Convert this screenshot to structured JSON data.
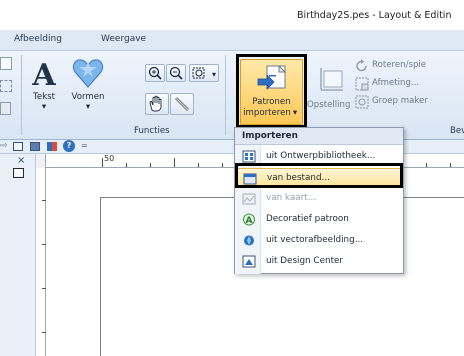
{
  "window": {
    "title": "Birthday2S.pes - Layout & Editin"
  },
  "menu": {
    "tabs": [
      {
        "label": "Afbeelding"
      },
      {
        "label": "Weergave"
      }
    ]
  },
  "ribbon": {
    "functies": {
      "group_label": "Functies",
      "tekst_label": "Tekst",
      "vormen_label": "Vormen"
    },
    "patronen": {
      "line1": "Patronen",
      "line2": "importeren"
    },
    "opstelling_label": "Opstelling",
    "right_group": {
      "items": [
        {
          "label": "Roteren/spie"
        },
        {
          "label": "Afmeting..."
        },
        {
          "label": "Groep maker"
        }
      ],
      "group_label_fragment": "Bev"
    }
  },
  "ruler": {
    "label_50": "50"
  },
  "dropdown": {
    "header": "Importeren",
    "items": [
      {
        "label": "uit Ontwerpbibliotheek...",
        "enabled": true,
        "icon": "library-icon"
      },
      {
        "label": "van bestand...",
        "enabled": true,
        "icon": "file-icon",
        "highlighted": true
      },
      {
        "label": "van kaart...",
        "enabled": false,
        "icon": "card-icon"
      },
      {
        "label": "Decoratief patroon",
        "enabled": true,
        "icon": "decorative-pattern-icon"
      },
      {
        "label": "uit vectorafbeelding...",
        "enabled": true,
        "icon": "vector-image-icon"
      },
      {
        "label": "uit Design Center",
        "enabled": true,
        "icon": "design-center-icon"
      }
    ]
  },
  "colors": {
    "highlight_fill": "#ffe49a",
    "highlight_border": "#e2b84f",
    "accent_blue": "#2f6fc0",
    "arrow_orange": "#f5a01e"
  }
}
